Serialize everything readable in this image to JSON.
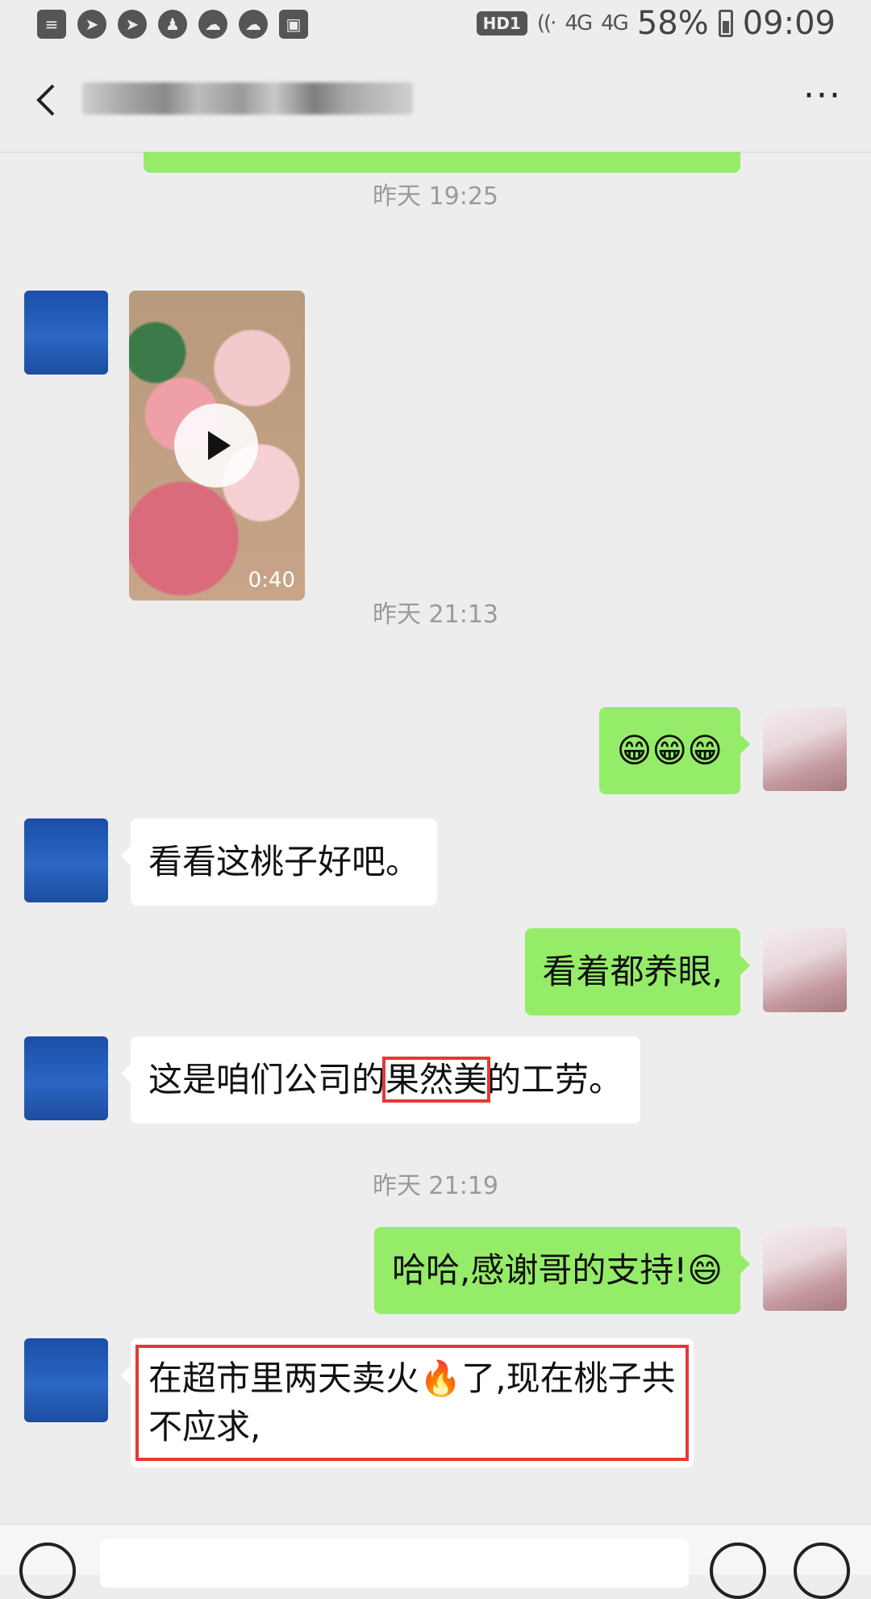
{
  "status_bar": {
    "battery": "58%",
    "time": "09:09",
    "network_badge": "HD1",
    "signal": "4G"
  },
  "navbar": {
    "contact_name": "",
    "more": "···"
  },
  "messages": [
    {
      "type": "timestamp",
      "text": "昨天 19:25"
    },
    {
      "type": "video",
      "sender": "friend",
      "duration": "0:40"
    },
    {
      "type": "timestamp",
      "text": "昨天 21:13"
    },
    {
      "type": "text",
      "sender": "me",
      "text": "😁😁😁"
    },
    {
      "type": "text",
      "sender": "friend",
      "text": "看看这桃子好吧。"
    },
    {
      "type": "text",
      "sender": "me",
      "text": "看着都养眼,"
    },
    {
      "type": "text",
      "sender": "friend",
      "parts": [
        "这是咱们公司的",
        "果然美",
        "的工劳。"
      ]
    },
    {
      "type": "timestamp",
      "text": "昨天 21:19"
    },
    {
      "type": "text",
      "sender": "me",
      "text": "哈哈,感谢哥的支持!😄"
    },
    {
      "type": "text",
      "sender": "friend",
      "lines": [
        "在超市里两天卖火🔥了,现在桃子共",
        "不应求,"
      ]
    }
  ],
  "colors": {
    "my_bubble": "#95ec69",
    "their_bubble": "#ffffff",
    "background": "#ededed",
    "highlight": "#e53935"
  }
}
